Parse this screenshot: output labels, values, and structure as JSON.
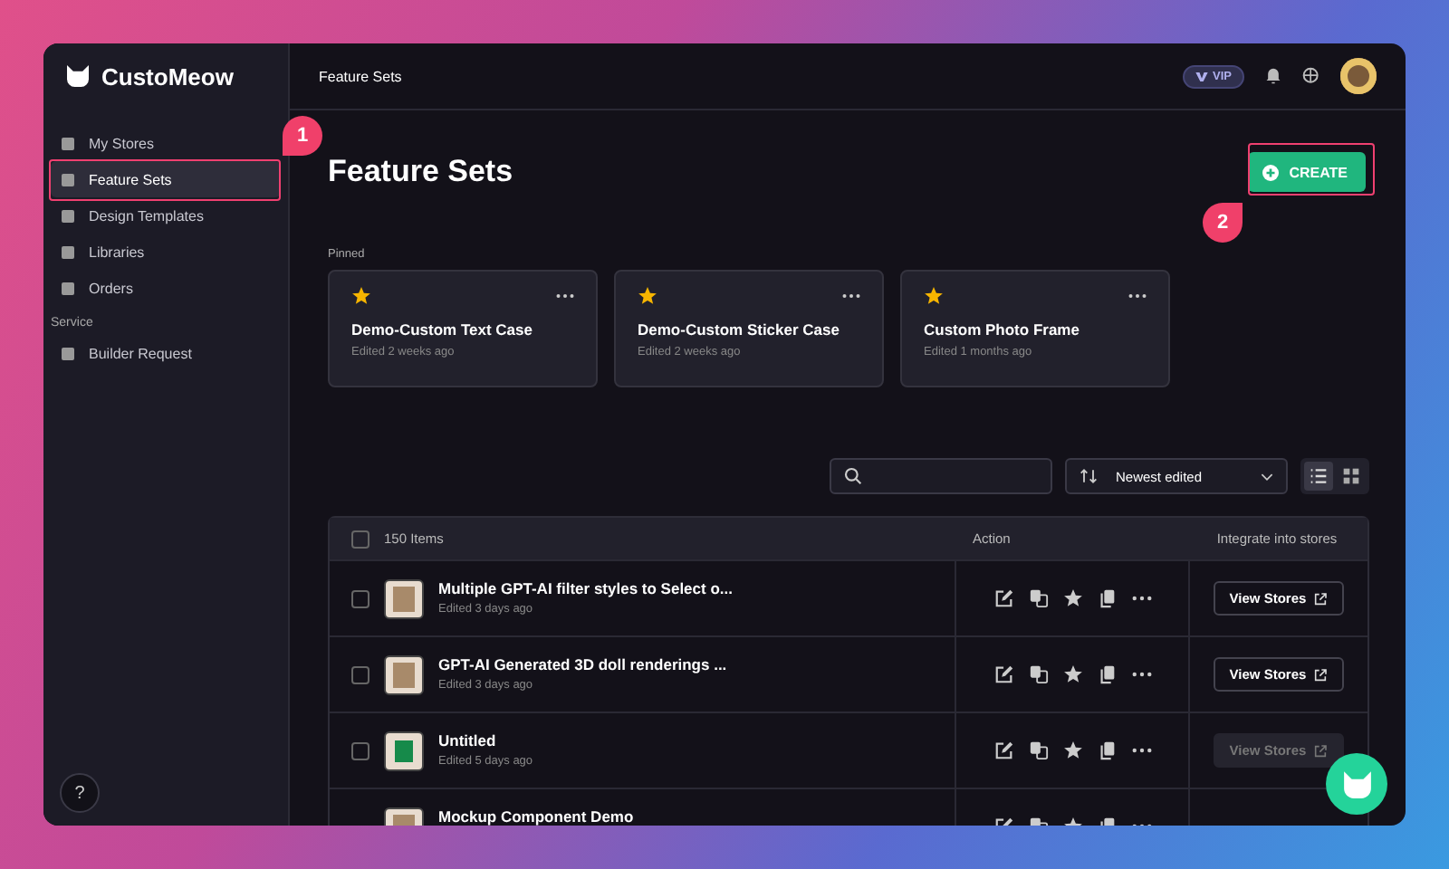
{
  "app": {
    "name": "CustoMeow"
  },
  "sidebar": {
    "items": [
      {
        "label": "My Stores",
        "selected": false
      },
      {
        "label": "Feature Sets",
        "selected": true
      },
      {
        "label": "Design Templates",
        "selected": false
      },
      {
        "label": "Libraries",
        "selected": false
      },
      {
        "label": "Orders",
        "selected": false
      }
    ],
    "section": "Service",
    "service_items": [
      {
        "label": "Builder Request",
        "selected": false
      }
    ],
    "help": "?"
  },
  "topbar": {
    "breadcrumb": "Feature Sets",
    "vip_badge": "VIP"
  },
  "page": {
    "title": "Feature Sets",
    "create_button": "CREATE"
  },
  "pinned": {
    "label": "Pinned",
    "cards": [
      {
        "title": "Demo-Custom Text Case",
        "meta": "Edited 2 weeks ago"
      },
      {
        "title": "Demo-Custom Sticker Case",
        "meta": "Edited 2 weeks ago"
      },
      {
        "title": "Custom Photo Frame",
        "meta": "Edited 1 months ago"
      }
    ]
  },
  "toolbar": {
    "sort": "Newest edited",
    "views": [
      {
        "kind": "list",
        "selected": true
      },
      {
        "kind": "grid",
        "selected": false
      }
    ]
  },
  "table": {
    "select_all_checked": false,
    "count": "150 Items",
    "columns": [
      "Action",
      "Integrate into stores"
    ],
    "rows": [
      {
        "checked": false,
        "title": "Multiple GPT-AI filter styles to Select o...",
        "meta": "Edited 3 days ago",
        "kind": "photo",
        "button": "View Stores",
        "disabled": false
      },
      {
        "checked": false,
        "title": "GPT-AI Generated 3D doll renderings ...",
        "meta": "Edited 3 days ago",
        "kind": "photo",
        "button": "View Stores",
        "disabled": false
      },
      {
        "checked": false,
        "title": "Untitled",
        "meta": "Edited 5 days ago",
        "kind": "mug",
        "button": "View Stores",
        "disabled": true
      },
      {
        "title": "Mockup Component Demo",
        "kind": "photo"
      }
    ]
  },
  "annotations": [
    {
      "label": "1"
    },
    {
      "label": "2"
    }
  ]
}
